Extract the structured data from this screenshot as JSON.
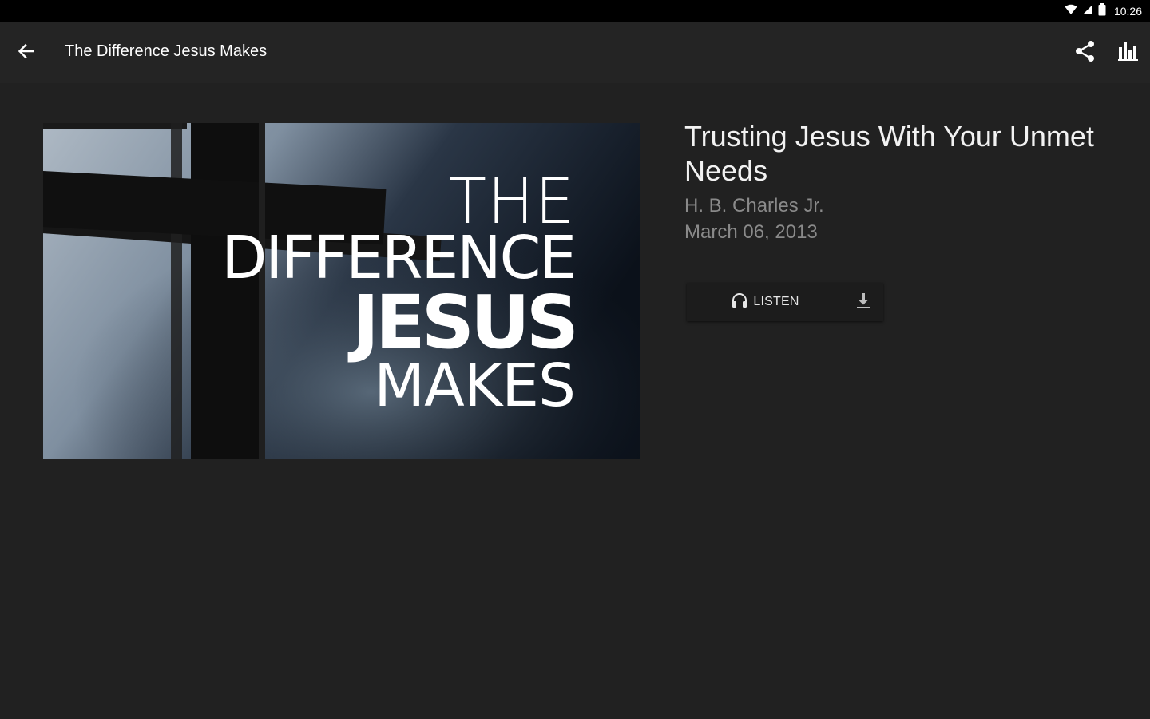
{
  "status_bar": {
    "time": "10:26",
    "icons": [
      "wifi-icon",
      "signal-icon",
      "battery-icon"
    ]
  },
  "app_bar": {
    "title": "The Difference Jesus Makes",
    "back_icon": "arrow-back-icon",
    "actions": [
      "share-icon",
      "bar-chart-icon"
    ]
  },
  "artwork": {
    "lines": [
      "THE",
      "DIFFERENCE",
      "JESUS",
      "MAKES"
    ]
  },
  "sermon": {
    "title": "Trusting Jesus With Your Unmet Needs",
    "speaker": "H. B. Charles Jr.",
    "date": "March 06, 2013"
  },
  "actions": {
    "listen_label": "LISTEN",
    "listen_icon": "headphones-icon",
    "download_icon": "download-icon"
  },
  "colors": {
    "background": "#212121",
    "app_bar": "#242424",
    "status_bar": "#000000",
    "secondary_text": "#8a8a8a"
  }
}
